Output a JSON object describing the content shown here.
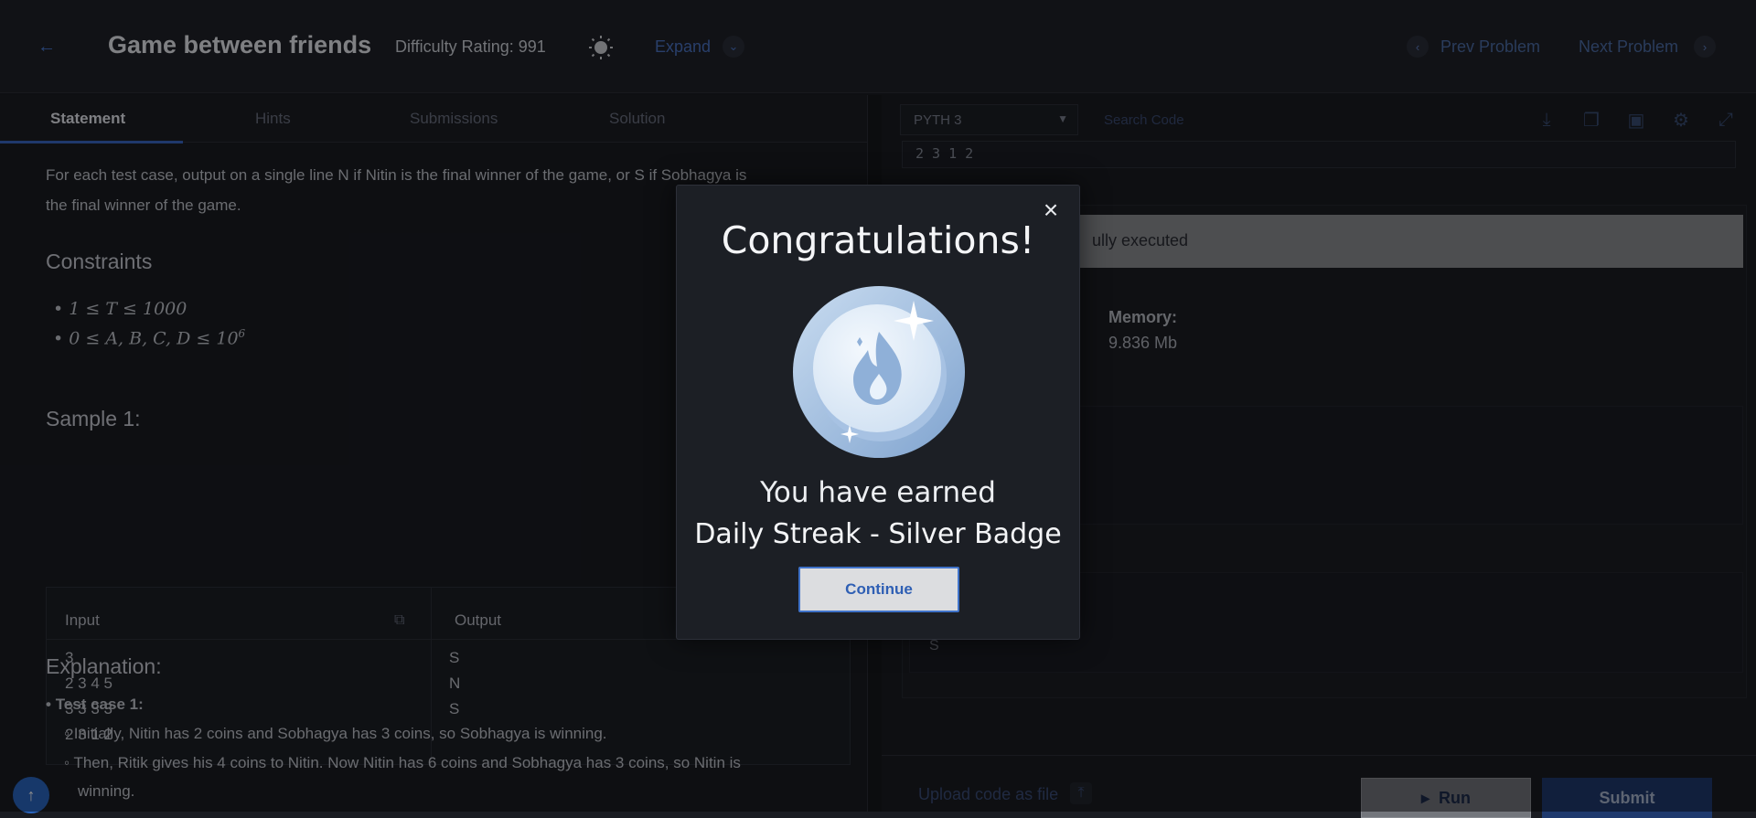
{
  "header": {
    "title": "Game between friends",
    "difficulty": "Difficulty Rating: 991",
    "expand": "Expand",
    "prev": "Prev Problem",
    "next": "Next Problem"
  },
  "tabs": [
    "Statement",
    "Hints",
    "Submissions",
    "Solution"
  ],
  "statement": {
    "output_line1": "For each test case, output on a single line N if Nitin is the final winner of the game, or S if Sobhagya is",
    "output_line2": "the final winner of the game.",
    "constraints_title": "Constraints",
    "constraint1": "1 ≤ T ≤ 1000",
    "constraint2": "0 ≤ A, B, C, D ≤ 10",
    "constraint2_exp": "6",
    "sample_title": "Sample 1:",
    "input_label": "Input",
    "output_label": "Output",
    "input_lines": [
      "3",
      "2 3 4 5",
      "3 3 3 3",
      "2 3 1 2"
    ],
    "output_lines": [
      "S",
      "N",
      "S"
    ],
    "explanation_title": "Explanation:",
    "test_case": "Test case 1:",
    "exp1": "Initially, Nitin has 2 coins and Sobhagya has 3 coins, so Sobhagya is winning.",
    "exp2": "Then, Ritik gives his 4 coins to Nitin. Now Nitin has 6 coins and Sobhagya has 3 coins, so Nitin is",
    "exp3": "winning."
  },
  "editor": {
    "language": "PYTH 3",
    "search_placeholder": "Search Code",
    "code_strip": "2 3 1 2",
    "banner": "ully executed",
    "memory_label": "Memory:",
    "memory_value": "9.836 Mb",
    "output_char": "S",
    "upload": "Upload code as file",
    "run": "Run",
    "submit": "Submit"
  },
  "modal": {
    "title": "Congratulations!",
    "earned": "You have earned",
    "badge_name": "Daily Streak - Silver Badge",
    "continue": "Continue"
  },
  "colors": {
    "accent": "#3a66c4",
    "badge_light": "#cfe0f2",
    "badge_dark": "#8fb0d8"
  }
}
